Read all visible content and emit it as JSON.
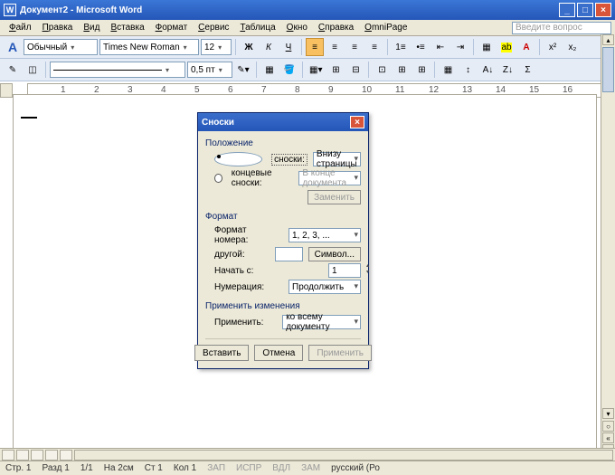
{
  "title": "Документ2 - Microsoft Word",
  "menu": [
    "Файл",
    "Правка",
    "Вид",
    "Вставка",
    "Формат",
    "Сервис",
    "Таблица",
    "Окно",
    "Справка",
    "OmniPage"
  ],
  "question_box": "Введите вопрос",
  "formatting": {
    "style": "Обычный",
    "font": "Times New Roman",
    "size": "12"
  },
  "toolbar2": {
    "line_width": "0,5 пт"
  },
  "ruler_marks": [
    "1",
    "2",
    "3",
    "4",
    "5",
    "6",
    "7",
    "8",
    "9",
    "10",
    "11",
    "12",
    "13",
    "14",
    "15",
    "16"
  ],
  "dialog": {
    "title": "Сноски",
    "section_position": "Положение",
    "radio_footnotes": "сноски:",
    "radio_endnotes": "концевые сноски:",
    "footnote_loc": "Внизу страницы",
    "endnote_loc": "В конце документа",
    "btn_convert": "Заменить",
    "section_format": "Формат",
    "lbl_number_format": "Формат номера:",
    "number_format": "1, 2, 3, ...",
    "lbl_other": "другой:",
    "btn_symbol": "Символ...",
    "lbl_start_at": "Начать с:",
    "start_at": "1",
    "lbl_numbering": "Нумерация:",
    "numbering": "Продолжить",
    "section_apply": "Применить изменения",
    "lbl_apply_to": "Применить:",
    "apply_to": "ко всему документу",
    "btn_insert": "Вставить",
    "btn_cancel": "Отмена",
    "btn_apply": "Применить"
  },
  "status": {
    "page": "Стр. 1",
    "section": "Разд 1",
    "pages": "1/1",
    "at": "На 2см",
    "line": "Ст 1",
    "col": "Кол 1",
    "ind": [
      "ЗАП",
      "ИСПР",
      "ВДЛ",
      "ЗАМ"
    ],
    "lang": "русский (Ро"
  }
}
